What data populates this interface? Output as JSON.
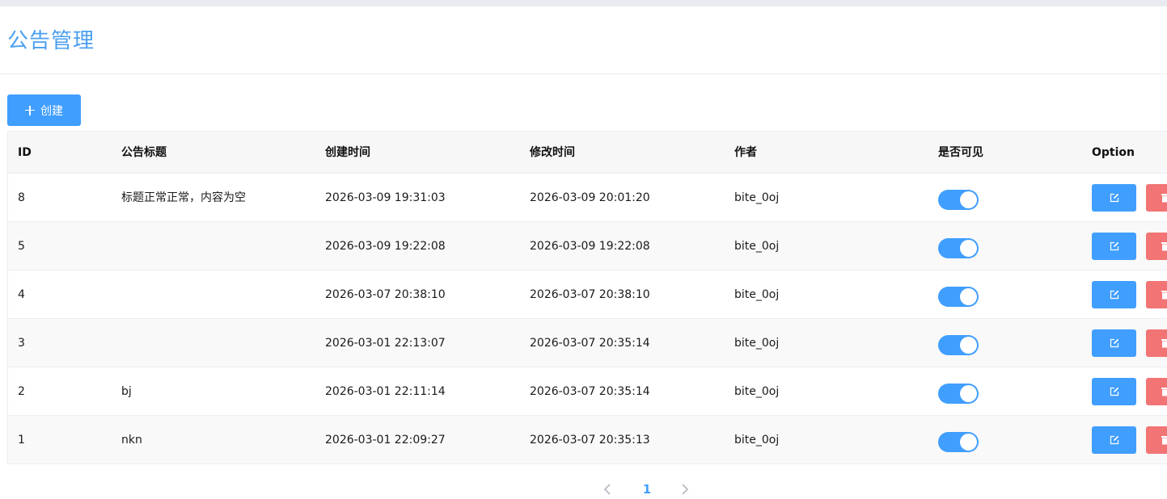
{
  "page": {
    "title": "公告管理",
    "create_button_label": "创建"
  },
  "table": {
    "columns": [
      "ID",
      "公告标题",
      "创建时间",
      "修改时间",
      "作者",
      "是否可见",
      "Option"
    ],
    "rows": [
      {
        "id": "8",
        "title": "标题正常正常，内容为空",
        "created": "2026-03-09 19:31:03",
        "modified": "2026-03-09 20:01:20",
        "author": "bite_0oj",
        "visible": true
      },
      {
        "id": "5",
        "title": "",
        "created": "2026-03-09 19:22:08",
        "modified": "2026-03-09 19:22:08",
        "author": "bite_0oj",
        "visible": true
      },
      {
        "id": "4",
        "title": "",
        "created": "2026-03-07 20:38:10",
        "modified": "2026-03-07 20:38:10",
        "author": "bite_0oj",
        "visible": true
      },
      {
        "id": "3",
        "title": "",
        "created": "2026-03-01 22:13:07",
        "modified": "2026-03-07 20:35:14",
        "author": "bite_0oj",
        "visible": true
      },
      {
        "id": "2",
        "title": "bj",
        "created": "2026-03-01 22:11:14",
        "modified": "2026-03-07 20:35:14",
        "author": "bite_0oj",
        "visible": true
      },
      {
        "id": "1",
        "title": "nkn",
        "created": "2026-03-01 22:09:27",
        "modified": "2026-03-07 20:35:13",
        "author": "bite_0oj",
        "visible": true
      }
    ]
  },
  "pagination": {
    "current_page": "1"
  },
  "icons": {
    "create": "plus-icon",
    "edit": "edit-icon",
    "delete": "trash-icon",
    "prev": "chevron-left-icon",
    "next": "chevron-right-icon"
  },
  "colors": {
    "accent": "#409eff",
    "title": "#4a9ef0",
    "danger": "#f27474"
  }
}
